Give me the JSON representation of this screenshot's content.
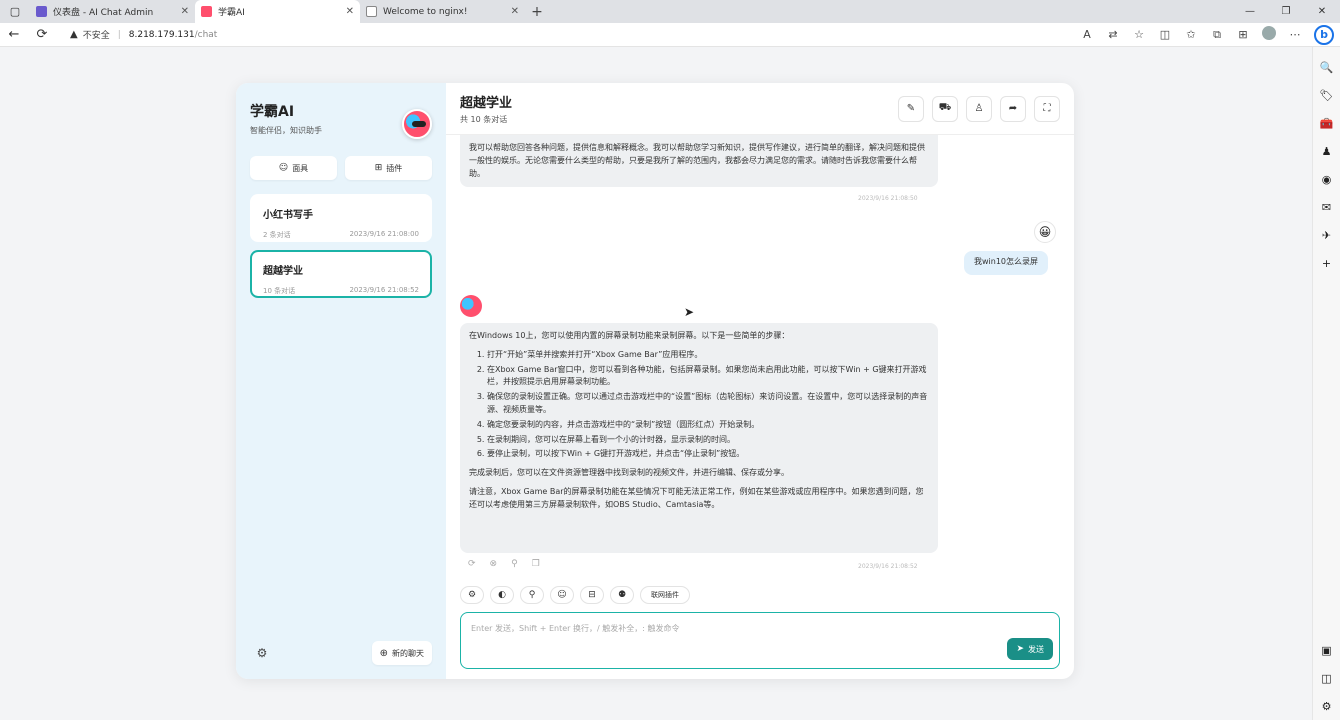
{
  "browser": {
    "tabs": [
      {
        "title": "仪表盘 - AI Chat Admin",
        "color": "#6a5acd"
      },
      {
        "title": "学霸AI",
        "color": "#ff4f6d"
      },
      {
        "title": "Welcome to nginx!",
        "color": "#888888"
      }
    ],
    "address": {
      "security_label": "不安全",
      "host": "8.218.179.131",
      "path": "/chat"
    }
  },
  "sidebar": {
    "brand_title": "学霸AI",
    "brand_subtitle": "智能伴侣，知识助手",
    "mask_button": "面具",
    "plugin_button": "插件",
    "sessions": [
      {
        "title": "小红书写手",
        "count": "2 条对话",
        "time": "2023/9/16 21:08:00"
      },
      {
        "title": "超越学业",
        "count": "10 条对话",
        "time": "2023/9/16 21:08:52"
      }
    ],
    "new_chat": "新的聊天"
  },
  "chat": {
    "title": "超越学业",
    "subtitle": "共 10 条对话",
    "messages": {
      "bot_1": "我可以帮助您回答各种问题，提供信息和解释概念。我可以帮助您学习新知识，提供写作建议，进行简单的翻译，解决问题和提供一般性的娱乐。无论您需要什么类型的帮助，只要是我所了解的范围内，我都会尽力满足您的需求。请随时告诉我您需要什么帮助。",
      "bot_1_time": "2023/9/16 21:08:50",
      "user_1": "我win10怎么录屏",
      "bot_2_intro": "在Windows 10上，您可以使用内置的屏幕录制功能来录制屏幕。以下是一些简单的步骤：",
      "bot_2_steps": [
        "打开“开始”菜单并搜索并打开“Xbox Game Bar”应用程序。",
        "在Xbox Game Bar窗口中，您可以看到各种功能，包括屏幕录制。如果您尚未启用此功能，可以按下Win + G键来打开游戏栏，并按照提示启用屏幕录制功能。",
        "确保您的录制设置正确。您可以通过点击游戏栏中的“设置”图标（齿轮图标）来访问设置。在设置中，您可以选择录制的声音源、视频质量等。",
        "确定您要录制的内容，并点击游戏栏中的“录制”按钮（圆形红点）开始录制。",
        "在录制期间，您可以在屏幕上看到一个小的计时器，显示录制的时间。",
        "要停止录制，可以按下Win + G键打开游戏栏，并点击“停止录制”按钮。"
      ],
      "bot_2_p2": "完成录制后，您可以在文件资源管理器中找到录制的视频文件，并进行编辑、保存或分享。",
      "bot_2_p3": "请注意，Xbox Game Bar的屏幕录制功能在某些情况下可能无法正常工作，例如在某些游戏或应用程序中。如果您遇到问题，您还可以考虑使用第三方屏幕录制软件，如OBS Studio、Camtasia等。",
      "bot_2_time": "2023/9/16 21:08:52"
    },
    "toolbar": {
      "web_plugin": "联网插件"
    },
    "composer": {
      "placeholder": "Enter 发送，Shift + Enter 换行，/ 触发补全，: 触发命令",
      "send": "发送"
    }
  },
  "colors": {
    "accent": "#1bb3a7",
    "send_button": "#1a8f87",
    "sidebar_bg": "#e8f4fb"
  }
}
